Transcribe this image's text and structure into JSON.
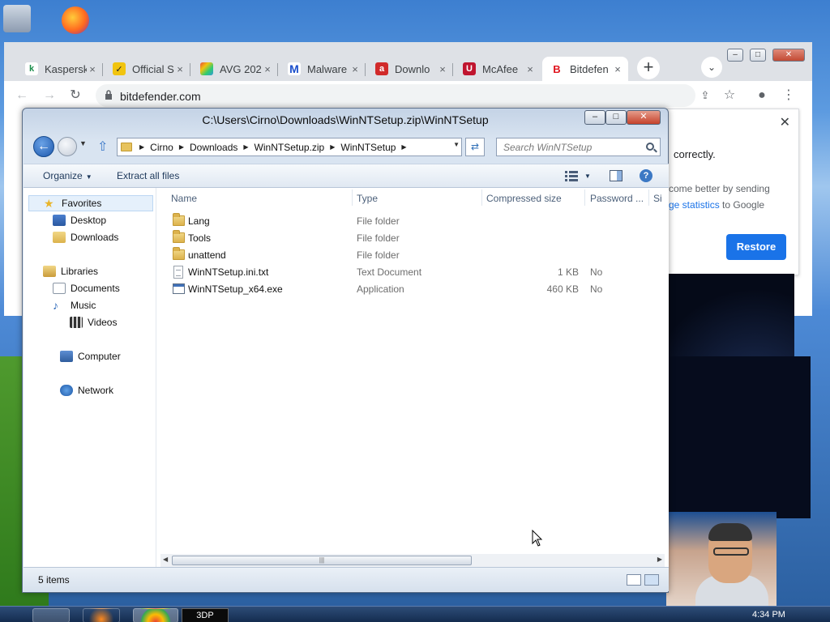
{
  "browser": {
    "tabs": [
      {
        "label": "Kaspersk",
        "favicon": "kaspersky-icon",
        "color": "#1a8d4b"
      },
      {
        "label": "Official S",
        "favicon": "checkmark-icon",
        "color": "#f1c40f"
      },
      {
        "label": "AVG 202",
        "favicon": "avg-icon",
        "color": "#e74c3c"
      },
      {
        "label": "Malware",
        "favicon": "malwarebytes-icon",
        "color": "#1b4fcc"
      },
      {
        "label": "Downlo",
        "favicon": "avira-icon",
        "color": "#d12a2a"
      },
      {
        "label": "McAfee",
        "favicon": "mcafee-icon",
        "color": "#c0152f"
      },
      {
        "label": "Bitdefen",
        "favicon": "bitdefender-icon",
        "color": "#e0141e"
      }
    ],
    "tab_close": "×",
    "new_tab": "+",
    "url": "bitdefender.com",
    "restore_prompt": {
      "title": "correctly.",
      "body_1": "come better by sending",
      "body_link": "ge statistics",
      "body_2": " to Google",
      "button": "Restore",
      "close": "✕"
    }
  },
  "explorer": {
    "title": "C:\\Users\\Cirno\\Downloads\\WinNTSetup.zip\\WinNTSetup",
    "breadcrumbs": [
      "Cirno",
      "Downloads",
      "WinNTSetup.zip",
      "WinNTSetup"
    ],
    "search_placeholder": "Search WinNTSetup",
    "toolbar": {
      "organize": "Organize",
      "extract": "Extract all files"
    },
    "nav": {
      "favorites": "Favorites",
      "desktop": "Desktop",
      "downloads": "Downloads",
      "libraries": "Libraries",
      "documents": "Documents",
      "music": "Music",
      "videos": "Videos",
      "computer": "Computer",
      "network": "Network"
    },
    "columns": {
      "name": "Name",
      "type": "Type",
      "compressed": "Compressed size",
      "password": "Password ...",
      "extra": "Si"
    },
    "files": [
      {
        "name": "Lang",
        "type": "File folder",
        "size": "",
        "password": "",
        "icon": "folder-icon"
      },
      {
        "name": "Tools",
        "type": "File folder",
        "size": "",
        "password": "",
        "icon": "folder-icon"
      },
      {
        "name": "unattend",
        "type": "File folder",
        "size": "",
        "password": "",
        "icon": "folder-icon"
      },
      {
        "name": "WinNTSetup.ini.txt",
        "type": "Text Document",
        "size": "1 KB",
        "password": "No",
        "icon": "text-file-icon"
      },
      {
        "name": "WinNTSetup_x64.exe",
        "type": "Application",
        "size": "460 KB",
        "password": "No",
        "icon": "exe-file-icon"
      }
    ],
    "status": "5 items"
  },
  "taskbar": {
    "app_3dp": "3DP",
    "clock": "4:34 PM"
  }
}
